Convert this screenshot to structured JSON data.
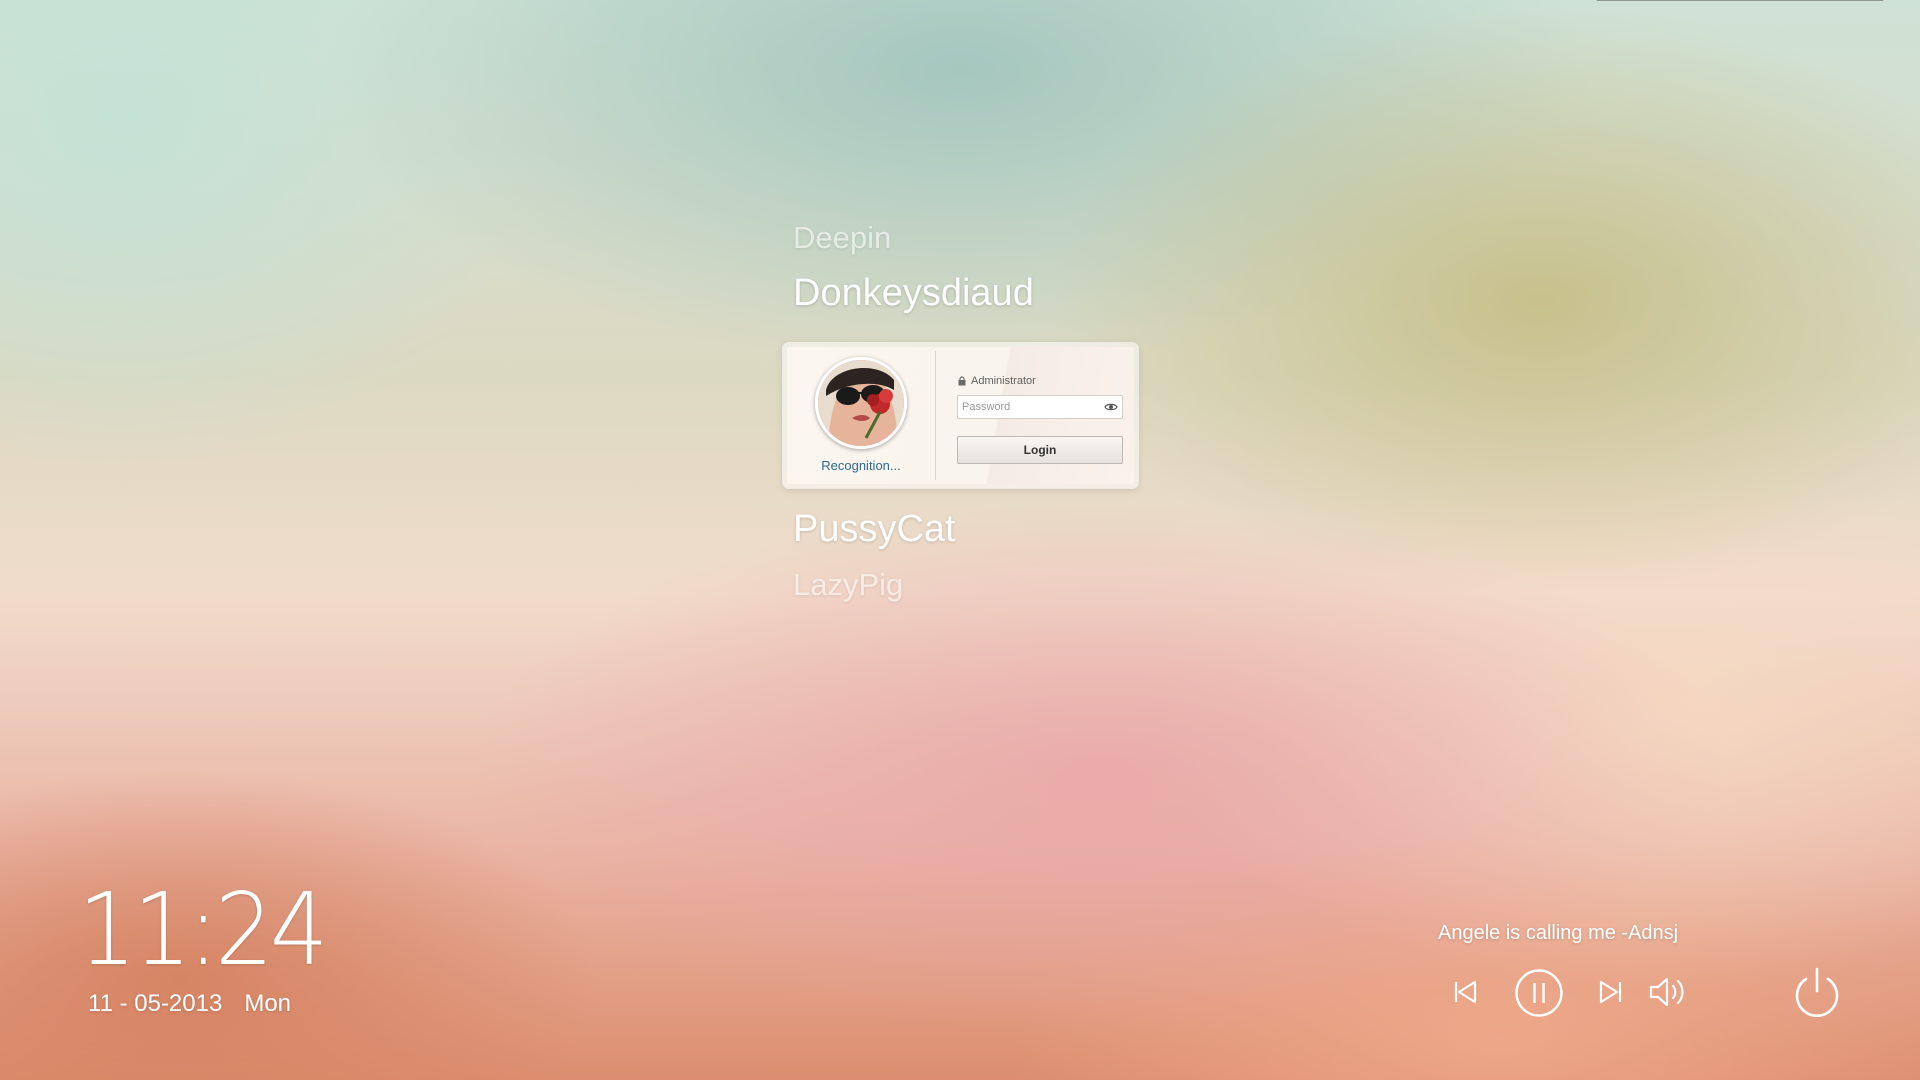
{
  "users": {
    "above_far": "Deepin",
    "above_near": "Donkeysdiaud",
    "below_near": "PussyCat",
    "below_far": "LazyPig"
  },
  "login_card": {
    "avatar_icon": "user-avatar-photo",
    "recognition_label": "Recognition...",
    "account_type": "Administrator",
    "lock_icon": "lock-icon",
    "password_placeholder": "Password",
    "password_value": "",
    "eye_icon": "eye-icon",
    "login_label": "Login"
  },
  "clock": {
    "time": "11:24",
    "date": "11 - 05-2013",
    "weekday": "Mon"
  },
  "media": {
    "song_title": "Angele is calling me -Adnsj",
    "prev_icon": "skip-previous-icon",
    "pause_icon": "pause-icon",
    "next_icon": "skip-next-icon",
    "volume_icon": "volume-icon"
  },
  "power": {
    "icon": "power-icon"
  },
  "colors": {
    "link": "#2d6a92",
    "text_on_wallpaper": "#ffffff"
  }
}
